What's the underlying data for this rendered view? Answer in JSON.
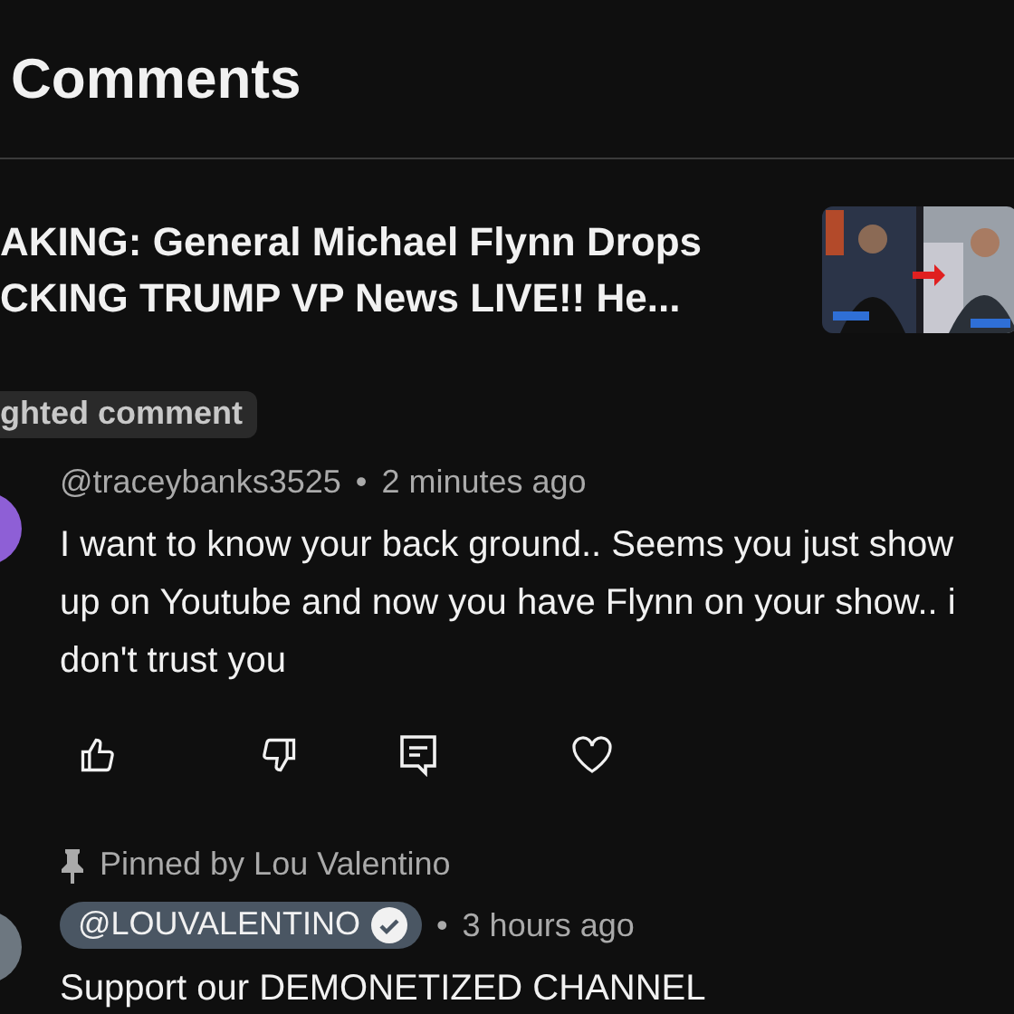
{
  "header": {
    "title": "Comments"
  },
  "video": {
    "title": "AKING: General Michael Flynn Drops\nCKING TRUMP VP News LIVE!! He..."
  },
  "highlight_label": "ghted comment",
  "comments": [
    {
      "kind": "viewer",
      "author": "@traceybanks3525",
      "separator": "•",
      "time": "2 minutes ago",
      "text": "I want to know your back ground.. Seems you just show up on Youtube and now you have Flynn on your show..  i don't trust you"
    },
    {
      "kind": "creator",
      "pinned_by": "Pinned by Lou Valentino",
      "author": "@LOUVALENTINO",
      "separator": "•",
      "time": "3 hours ago",
      "text": "Support our DEMONETIZED CHANNEL"
    }
  ]
}
